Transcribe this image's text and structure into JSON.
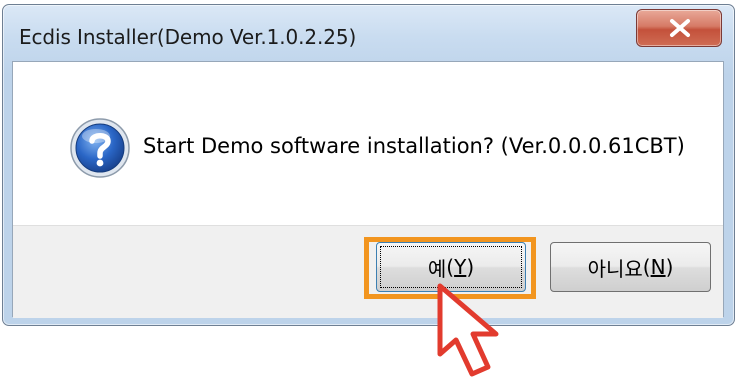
{
  "window": {
    "title": "Ecdis Installer(Demo Ver.1.0.2.25)",
    "close_icon": "close-icon"
  },
  "dialog": {
    "icon": "question-icon",
    "message": "Start Demo software installation? (Ver.0.0.0.61CBT)"
  },
  "buttons": {
    "yes": {
      "label": "예",
      "accel_open": "(",
      "accel_key": "Y",
      "accel_close": ")"
    },
    "no": {
      "label": "아니요",
      "accel_open": "(",
      "accel_key": "N",
      "accel_close": ")"
    }
  },
  "annotation": {
    "highlight_color": "#f2951f",
    "cursor_icon": "pointer-arrow-icon"
  }
}
